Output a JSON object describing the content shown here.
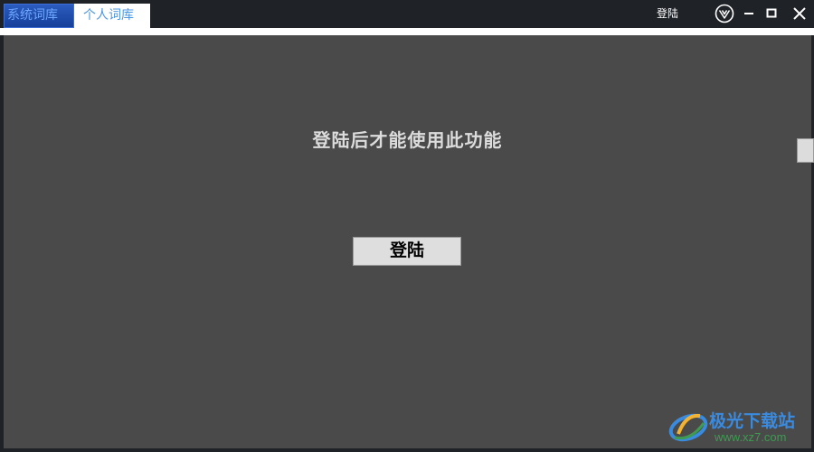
{
  "tabs": {
    "system": "系统词库",
    "personal": "个人词库"
  },
  "titlebar": {
    "login_label": "登陆"
  },
  "main": {
    "message": "登陆后才能使用此功能",
    "login_button": "登陆"
  },
  "watermark": {
    "line1": "极光下载站",
    "line2": "www.xz7.com"
  },
  "colors": {
    "titlebar_bg": "#1f2227",
    "content_bg": "#4a4a4a",
    "tab_active_bg": "#ffffff",
    "tab_active_text": "#4b97e0",
    "tab_system_bg": "#1f4aa8"
  },
  "icons": [
    "app-logo-icon",
    "minimize-icon",
    "maximize-icon",
    "close-icon"
  ]
}
